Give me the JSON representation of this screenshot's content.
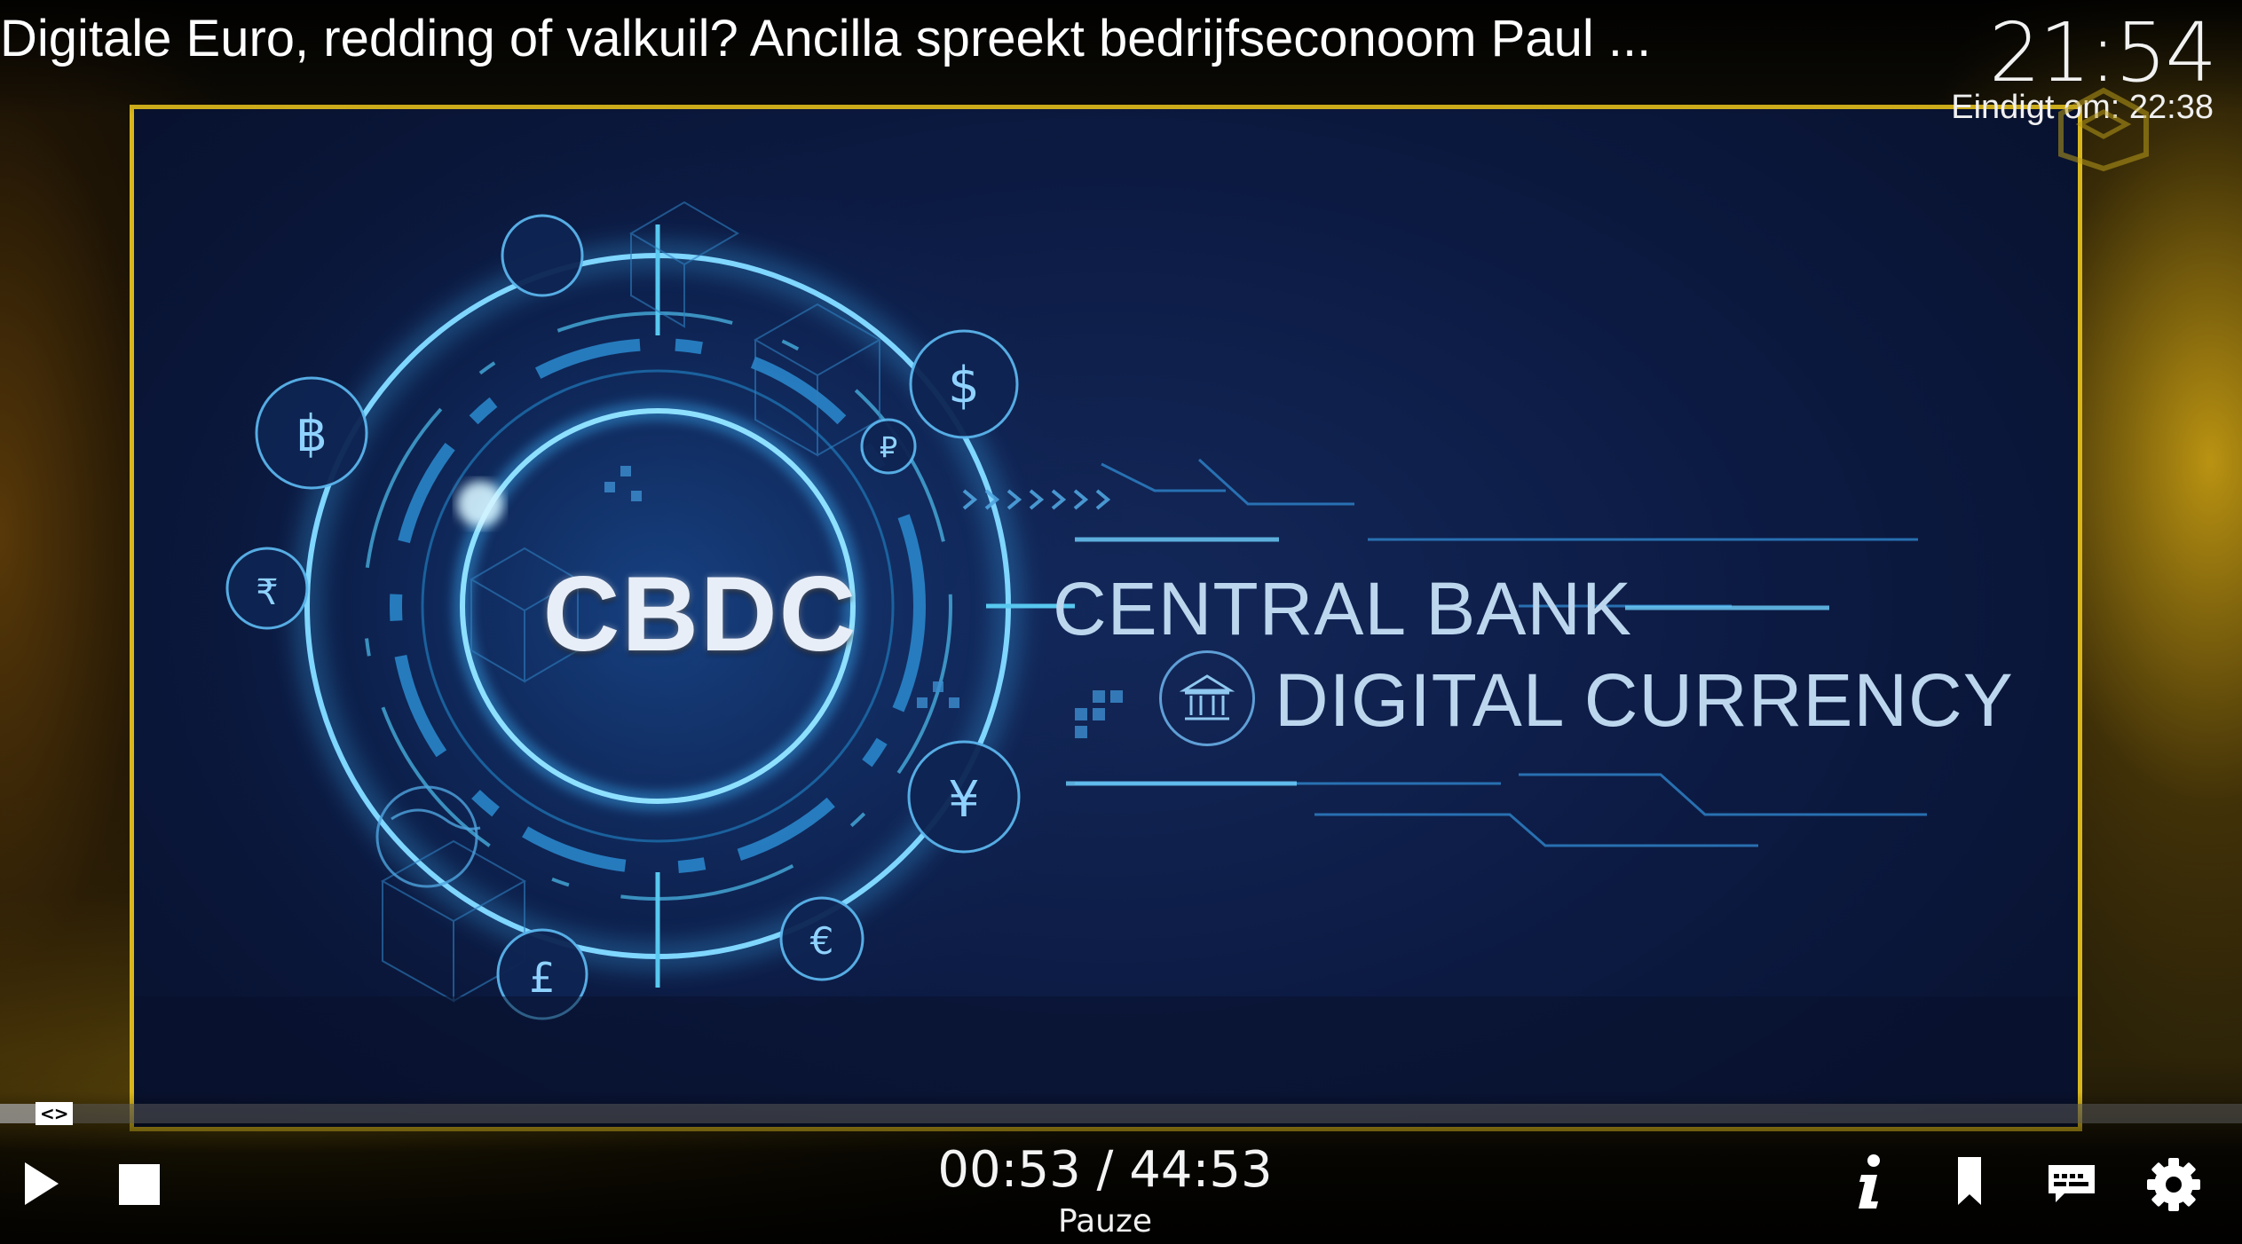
{
  "header": {
    "title": "Digitale Euro, redding of valkuil? Ancilla spreekt bedrijfseconoom Paul ...",
    "clock": "21:54",
    "ends_at": "Eindigt om: 22:38"
  },
  "slide": {
    "badge": "CBDC",
    "line1": "CENTRAL BANK",
    "line2": "DIGITAL CURRENCY"
  },
  "playback": {
    "elapsed": "00:53",
    "total": "44:53",
    "time_display": "00:53 / 44:53",
    "status": "Pauze",
    "progress_fraction": 0.0197,
    "seek_handle_glyph": "<>"
  },
  "controls": {
    "left": [
      "play-icon",
      "stop-icon"
    ],
    "right": [
      "info-icon",
      "bookmark-icon",
      "subtitles-icon",
      "settings-icon"
    ]
  },
  "colors": {
    "frame_border": "#d9b71c",
    "slide_bg": "#0c1a42",
    "glow": "#3fb8ff",
    "text": "#ffffff"
  }
}
